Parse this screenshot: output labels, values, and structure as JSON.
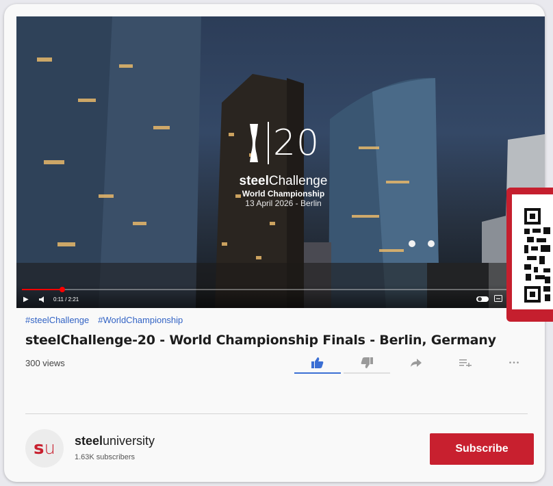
{
  "video": {
    "overlay": {
      "number": "20",
      "brand_bold": "steel",
      "brand_light": "Challenge",
      "subtitle": "World Championship",
      "date_location": "13 April 2026 - Berlin"
    },
    "controls": {
      "time": "0:11 / 2:21",
      "progress_fraction": 0.078
    }
  },
  "hashtags": [
    "#steelChallenge",
    "#WorldChampionship"
  ],
  "title": "steelChallenge-20 - World Championship Finals - Berlin, Germany",
  "views": "300 views",
  "actions": {
    "like_icon": "thumbs-up-icon",
    "dislike_icon": "thumbs-down-icon",
    "share_icon": "share-icon",
    "save_icon": "add-to-playlist-icon",
    "more_icon": "more-icon",
    "more_glyph": "•••",
    "accent": "#3b6fd4"
  },
  "channel": {
    "avatar_s": "s",
    "avatar_u": "u",
    "name_bold": "steel",
    "name_light": "university",
    "subscribers": "1.63K subscribers"
  },
  "subscribe_label": "Subscribe",
  "colors": {
    "brand_red": "#c8202f",
    "link_blue": "#3162c4"
  }
}
